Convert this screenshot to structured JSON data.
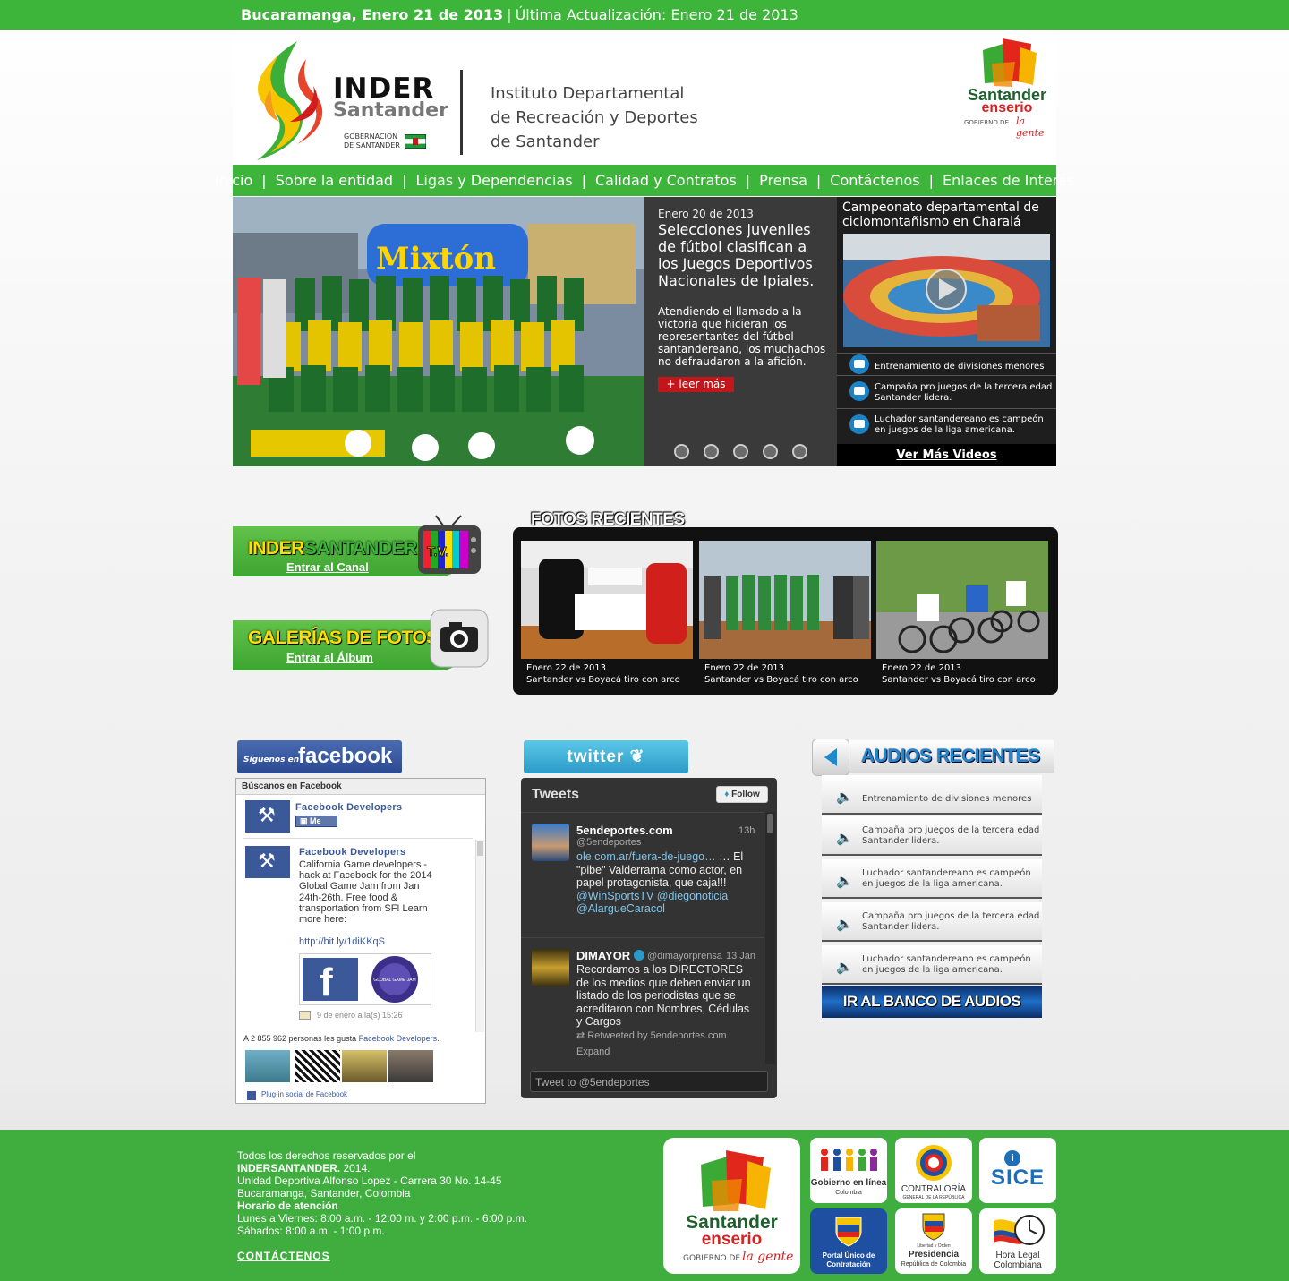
{
  "topbar": {
    "date": "Bucaramanga, Enero 21 de 2013",
    "separator": "|",
    "update": "Última Actualización: Enero 21 de 2013"
  },
  "header": {
    "logo_name": "INDER",
    "logo_sub": "Santander",
    "gob_line1": "GOBERNACION",
    "gob_line2": "DE SANTANDER",
    "inst_line1": "Instituto Departamental",
    "inst_line2": "de Recreación y Deportes",
    "inst_line3": "de Santander",
    "seal_line1": "Santander",
    "seal_line2": "enserio",
    "seal_line3": "GOBIERNO DE",
    "seal_line4": "la gente"
  },
  "nav": {
    "separator": "|",
    "items": [
      "Inicio",
      "Sobre la entidad",
      "Ligas y Dependencias",
      "Calidad y Contratos",
      "Prensa",
      "Contáctenos",
      "Enlaces de Interés"
    ]
  },
  "slider": {
    "date": "Enero 20 de 2013",
    "headline": "Selecciones juveniles de fútbol clasifican a los Juegos Deportivos Nacionales de Ipiales.",
    "summary": "Atendiendo el llamado a la victoria que hicieran los representantes del fútbol santandereano, los muchachos no defraudaron a la afición.",
    "read_more": "+ leer más",
    "banner_text": "Mixtón"
  },
  "videos": {
    "title": "Campeonato departamental de ciclomontañismo en Charalá",
    "items": [
      "Entrenamiento de divisiones menores",
      "Campaña pro juegos de la tercera edad Santander lidera.",
      "Luchador santandereano es campeón en juegos de la liga americana."
    ],
    "more": "Ver Más Videos"
  },
  "promos": {
    "tv_title_a": "INDER",
    "tv_title_b": "SANTANDER",
    "tv_badge": "T.V.",
    "tv_link": "Entrar al Canal",
    "gal_title": "GALERÍAS DE FOTOS",
    "gal_link": "Entrar al Álbum"
  },
  "fotos": {
    "title": "FOTOS RECIENTES",
    "items": [
      {
        "date": "Enero 22 de 2013",
        "caption": "Santander vs Boyacá tiro con arco"
      },
      {
        "date": "Enero 22 de 2013",
        "caption": "Santander vs Boyacá tiro con arco"
      },
      {
        "date": "Enero 22 de 2013",
        "caption": "Santander vs Boyacá tiro con arco"
      }
    ]
  },
  "facebook": {
    "banner_small": "Síguenos en",
    "banner_big": "facebook",
    "head": "Búscanos en Facebook",
    "page_name": "Facebook Developers",
    "like": "Me gusta",
    "post_author": "Facebook Developers",
    "post_body": "California Game developers - hack at Facebook for the 2014 Global Game Jam from Jan 24th-26th. Free food & transportation from SF! Learn more here:",
    "post_link": "http://bit.ly/1diKKqS",
    "post_time": "9 de enero a la(s) 15:26",
    "count_prefix": "A 2 855 962 personas les gusta",
    "count_link": "Facebook Developers.",
    "plugin": "Plug-in social de Facebook",
    "img_letter": "f",
    "img_badge": "GLOBAL GAME JAM"
  },
  "twitter": {
    "banner": "twitter",
    "head": "Tweets",
    "follow": "Follow",
    "tweets": [
      {
        "user": "5endeportes.com",
        "handle": "@5endeportes",
        "time": "13h",
        "link": "ole.com.ar/fuera-de-juego…",
        "body": " … El \"pibe\" Valderrama como actor, en papel protagonista, que caja!!! ",
        "mentions": "@WinSportsTV @diegonoticia @AlargueCaracol"
      },
      {
        "user": "DIMAYOR",
        "handle": "@dimayorprensa",
        "time": "13 Jan",
        "body": "Recordamos a los DIRECTORES de los medios que deben enviar un listado de los periodistas que se acreditaron con Nombres, Cédulas y Cargos",
        "retweet": "Retweeted by 5endeportes.com",
        "expand": "Expand"
      }
    ],
    "input_placeholder": "Tweet to @5endeportes"
  },
  "audios": {
    "title": "AUDIOS RECIENTES",
    "items": [
      "Entrenamiento de divisiones menores",
      "Campaña pro juegos de la tercera edad Santander lidera.",
      "Luchador santandereano es campeón en juegos de la liga americana.",
      "Campaña pro juegos de la tercera edad Santander lidera.",
      "Luchador santandereano es campeón en juegos de la liga americana."
    ],
    "bank": "IR AL BANCO DE AUDIOS"
  },
  "footer": {
    "line1": "Todos los derechos reservados por el",
    "line2_bold": "INDERSANTANDER.",
    "line2_rest": " 2014.",
    "line3": "Unidad Deportiva Alfonso Lopez - Carrera 30 No. 14-45",
    "line4": "Bucaramanga, Santander, Colombia",
    "line5_bold": "Horario de atención",
    "line6": "Lunes a Viernes: 8:00 a.m. - 12:00 m. y 2:00 p.m. - 6:00 p.m.",
    "line7": "Sábados: 8:00 a.m. - 1:00 p.m.",
    "contact": "CONTÁCTENOS",
    "logos": {
      "gobierno": "Gobierno en línea",
      "gobierno_sub": "Colombia",
      "contraloria": "CONTRALORÍA",
      "contraloria_sub": "GENERAL DE LA REPÚBLICA",
      "sice": "SICE",
      "portal": "Portal Único de Contratación",
      "presidencia_sub0": "Libertad y Orden",
      "presidencia": "Presidencia",
      "presidencia_sub": "República de Colombia",
      "hora": "Hora Legal",
      "hora_sub": "Colombiana"
    }
  },
  "colors": {
    "brand_green": "#3db53b",
    "footer_green": "#3fae3f",
    "read_more_red": "#c2161a",
    "facebook_blue": "#3b5998",
    "audio_blue": "#1f87cc"
  }
}
